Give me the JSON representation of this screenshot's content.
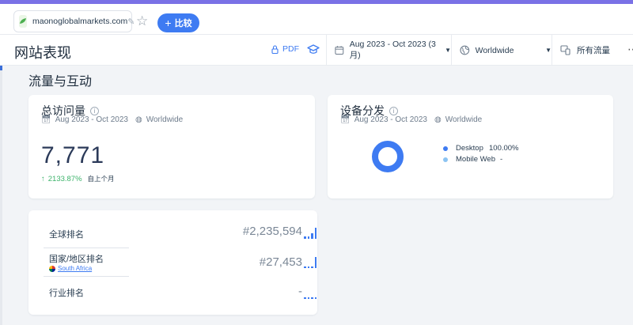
{
  "top_bar": {
    "domain": "maonoglobalmarkets.com",
    "compare_label": "比较"
  },
  "header": {
    "title": "网站表现",
    "pdf_label": "PDF",
    "date_range": "Aug 2023 - Oct 2023 (3 月)",
    "region": "Worldwide",
    "traffic_type": "所有流量"
  },
  "section_title": "流量与互动",
  "total_visits": {
    "title": "总访问量",
    "date": "Aug 2023 - Oct 2023",
    "region": "Worldwide",
    "value": "7,771",
    "change": "2133.87%",
    "change_label": "自上个月"
  },
  "device": {
    "title": "设备分发",
    "date": "Aug 2023 - Oct 2023",
    "region": "Worldwide",
    "items": [
      {
        "label": "Desktop",
        "value": "100.00%",
        "color": "#3e7bf2"
      },
      {
        "label": "Mobile Web",
        "value": "-",
        "color": "#8cc4f2"
      }
    ]
  },
  "ranks": {
    "global_label": "全球排名",
    "global_value": "#2,235,594",
    "country_label": "国家/地区排名",
    "country_name": "South Africa",
    "country_value": "#27,453",
    "industry_label": "行业排名",
    "industry_value": "-"
  },
  "colors": {
    "accent": "#7a71e6",
    "primary": "#3e7bf2",
    "positive": "#3db36b"
  }
}
